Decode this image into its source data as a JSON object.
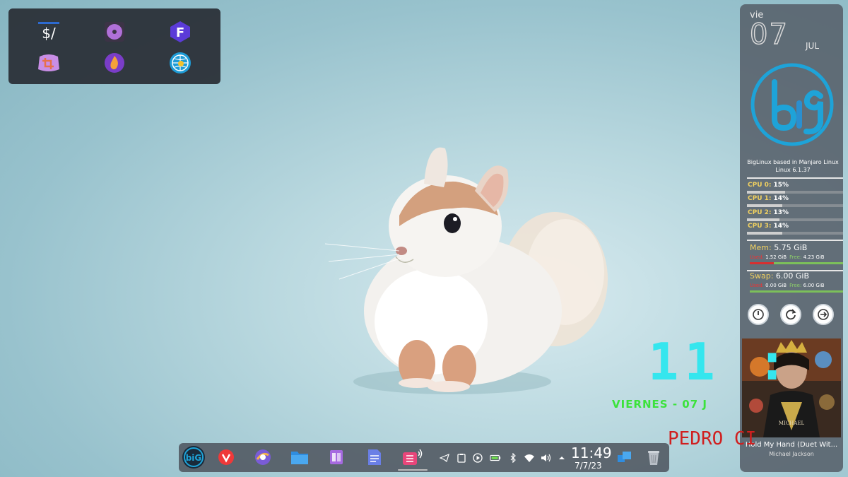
{
  "launcher": {
    "icons": [
      "terminal-dollar-icon",
      "disc-burner-icon",
      "font-app-icon",
      "crop-tool-icon",
      "firewall-flame-icon",
      "globe-browser-icon"
    ]
  },
  "sidebar": {
    "day": "vie",
    "date_number": "07",
    "month": "JUL",
    "distro_line1": "BigLinux based in Manjaro Linux",
    "distro_line2": "Linux 6.1.37",
    "cpus": [
      {
        "label": "CPU 0:",
        "value": "15%",
        "percent": 15
      },
      {
        "label": "CPU 1:",
        "value": "14%",
        "percent": 14
      },
      {
        "label": "CPU 2:",
        "value": "13%",
        "percent": 13
      },
      {
        "label": "CPU 3:",
        "value": "14%",
        "percent": 14
      }
    ],
    "mem": {
      "label": "Mem:",
      "total": "5.75 GiB",
      "used_label": "Used:",
      "used": "1.52 GiB",
      "free_label": "Free:",
      "free": "4.23 GiB",
      "used_fraction": 0.26
    },
    "swap": {
      "label": "Swap:",
      "total": "6.00 GiB",
      "used_label": "Used:",
      "used": "0.00 GiB",
      "free_label": "Free:",
      "free": "6.00 GiB",
      "used_fraction": 0.0
    },
    "power_buttons": [
      "power-icon",
      "restart-icon",
      "logout-icon"
    ],
    "media": {
      "album_text": "MICHAEL",
      "title": "Hold My Hand (Duet Wit...",
      "artist": "Michael Jackson"
    }
  },
  "desktop": {
    "clock_big": "11 :",
    "day_line": "VIERNES - 07 J",
    "user_name": "PEDRO CI"
  },
  "taskbar": {
    "apps": [
      "biglinux-menu-icon",
      "vivaldi-icon",
      "browser-icon",
      "files-icon",
      "office-icon",
      "documents-icon",
      "sound-app-icon"
    ],
    "tray": [
      "telegram-icon",
      "clipboard-icon",
      "media-play-icon",
      "battery-icon",
      "bluetooth-icon",
      "wifi-icon",
      "volume-icon",
      "expand-tray-icon"
    ],
    "time": "11:49",
    "date": "7/7/23",
    "extra": [
      "workspace-icon",
      "trash-icon"
    ]
  },
  "colors": {
    "clock": "#35e6ee",
    "day_line": "#3be23b",
    "user_name": "#d01f1f",
    "cpu_label": "#f0d060",
    "mem_used": "#d83030",
    "mem_free": "#7cc05a"
  }
}
